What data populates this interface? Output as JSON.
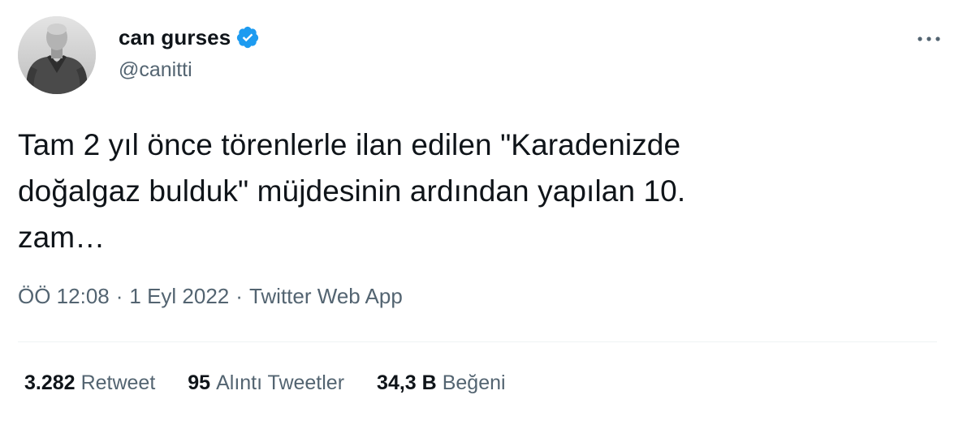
{
  "user": {
    "display_name": "can gurses",
    "handle": "@canitti",
    "verified": true,
    "avatar_icon": "profile-photo-bw"
  },
  "tweet": {
    "lines": [
      "Tam 2 yıl önce törenlerle ilan edilen \"Karadenizde",
      "doğalgaz bulduk\" müjdesinin ardından yapılan 10.",
      "zam…"
    ]
  },
  "meta": {
    "time": "ÖÖ 12:08",
    "separator": "·",
    "date": "1 Eyl 2022",
    "source": "Twitter Web App"
  },
  "stats": [
    {
      "count": "3.282",
      "label": "Retweet"
    },
    {
      "count": "95",
      "label": "Alıntı Tweetler"
    },
    {
      "count": "34,3 B",
      "label": "Beğeni"
    }
  ],
  "icons": {
    "more": "more-horizontal-icon",
    "verified": "verified-badge-icon"
  },
  "colors": {
    "verified_blue": "#1d9bf0",
    "secondary_text": "#536471",
    "primary_text": "#0f1419",
    "divider": "#eff3f4"
  }
}
